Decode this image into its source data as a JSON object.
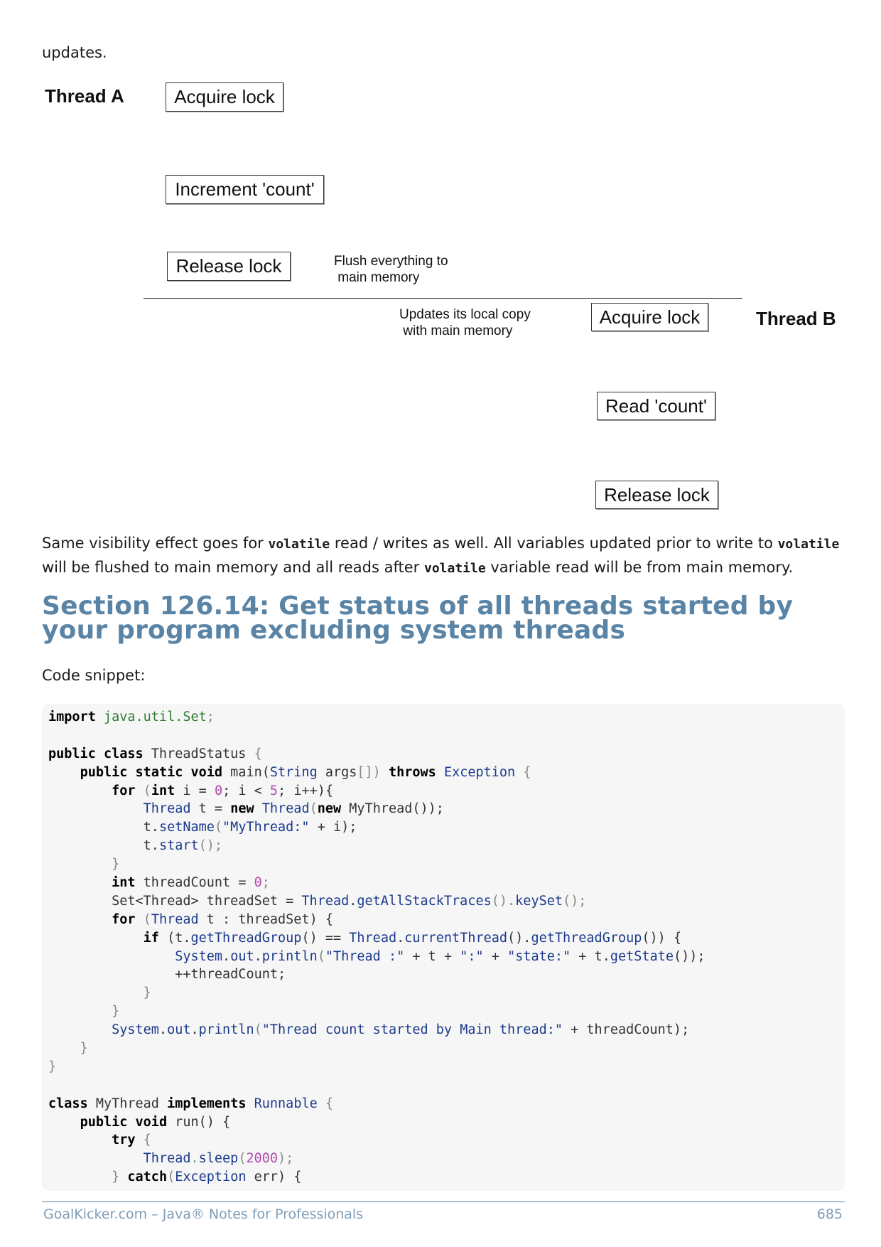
{
  "intro_text": "updates.",
  "diagram": {
    "thread_a_label": "Thread A",
    "thread_b_label": "Thread B",
    "a_acquire": "Acquire lock",
    "a_increment": "Increment 'count'",
    "a_release": "Release lock",
    "flush_note": "Flush everything to\n main memory",
    "update_note": "Updates its local copy\n with main memory",
    "b_acquire": "Acquire lock",
    "b_read": "Read 'count'",
    "b_release": "Release lock"
  },
  "paragraph": {
    "p1": "Same visibility effect goes for ",
    "c1": "volatile",
    "p2": " read / writes as well. All variables updated prior to write to ",
    "c2": "volatile",
    "p3": " will be flushed to main memory and all reads after ",
    "c3": "volatile",
    "p4": " variable read will be from main memory."
  },
  "section_title": "Section 126.14: Get status of all threads started by your program excluding system threads",
  "snippet_label": "Code snippet:",
  "code": {
    "l01": [
      "import",
      " ",
      "java.util.Set",
      ";"
    ],
    "l03": [
      "public class",
      " ThreadStatus ",
      "{"
    ],
    "l04": [
      "    ",
      "public static void",
      " main(",
      "String",
      " args",
      "[])",
      " ",
      "throws",
      " ",
      "Exception",
      " {"
    ],
    "l05": [
      "        ",
      "for",
      " (",
      "int",
      " i = ",
      "0",
      "; i < ",
      "5",
      "; i++){"
    ],
    "l06": [
      "            ",
      "Thread",
      " t = ",
      "new",
      " ",
      "Thread",
      "(",
      "new",
      " MyThread());"
    ],
    "l07": [
      "            t.",
      "setName",
      "(",
      "\"MyThread:\"",
      " + i);"
    ],
    "l08": [
      "            t.",
      "start",
      "();"
    ],
    "l09": [
      "        }"
    ],
    "l10": [
      "        ",
      "int",
      " threadCount = ",
      "0",
      ";"
    ],
    "l11": [
      "        Set<Thread> threadSet = ",
      "Thread",
      ".",
      "getAllStackTraces",
      "().",
      "keySet",
      "();"
    ],
    "l12": [
      "        ",
      "for",
      " (",
      "Thread",
      " t : threadSet) {"
    ],
    "l13": [
      "            ",
      "if",
      " (t.",
      "getThreadGroup",
      "() == ",
      "Thread",
      ".",
      "currentThread",
      "().",
      "getThreadGroup",
      "()) {"
    ],
    "l14": [
      "                ",
      "System",
      ".",
      "out",
      ".",
      "println",
      "(",
      "\"Thread :\"",
      " + t + ",
      "\":\"",
      " + ",
      "\"state:\"",
      " + t.",
      "getState",
      "());"
    ],
    "l15": [
      "                ++threadCount;"
    ],
    "l16": [
      "            }"
    ],
    "l17": [
      "        }"
    ],
    "l18": [
      "        ",
      "System",
      ".",
      "out",
      ".",
      "println",
      "(",
      "\"Thread count started by Main thread:\"",
      " + threadCount);"
    ],
    "l19": [
      "    }"
    ],
    "l20": [
      "}"
    ],
    "l22": [
      "class",
      " MyThread ",
      "implements",
      " ",
      "Runnable",
      " {"
    ],
    "l23": [
      "    ",
      "public void",
      " run() {"
    ],
    "l24": [
      "        ",
      "try",
      " {"
    ],
    "l25": [
      "            ",
      "Thread",
      ".",
      "sleep",
      "(",
      "2000",
      ");"
    ],
    "l26": [
      "        } ",
      "catch",
      "(",
      "Exception",
      " err) {"
    ]
  },
  "footer": {
    "left": "GoalKicker.com – Java® Notes for Professionals",
    "page": "685"
  }
}
